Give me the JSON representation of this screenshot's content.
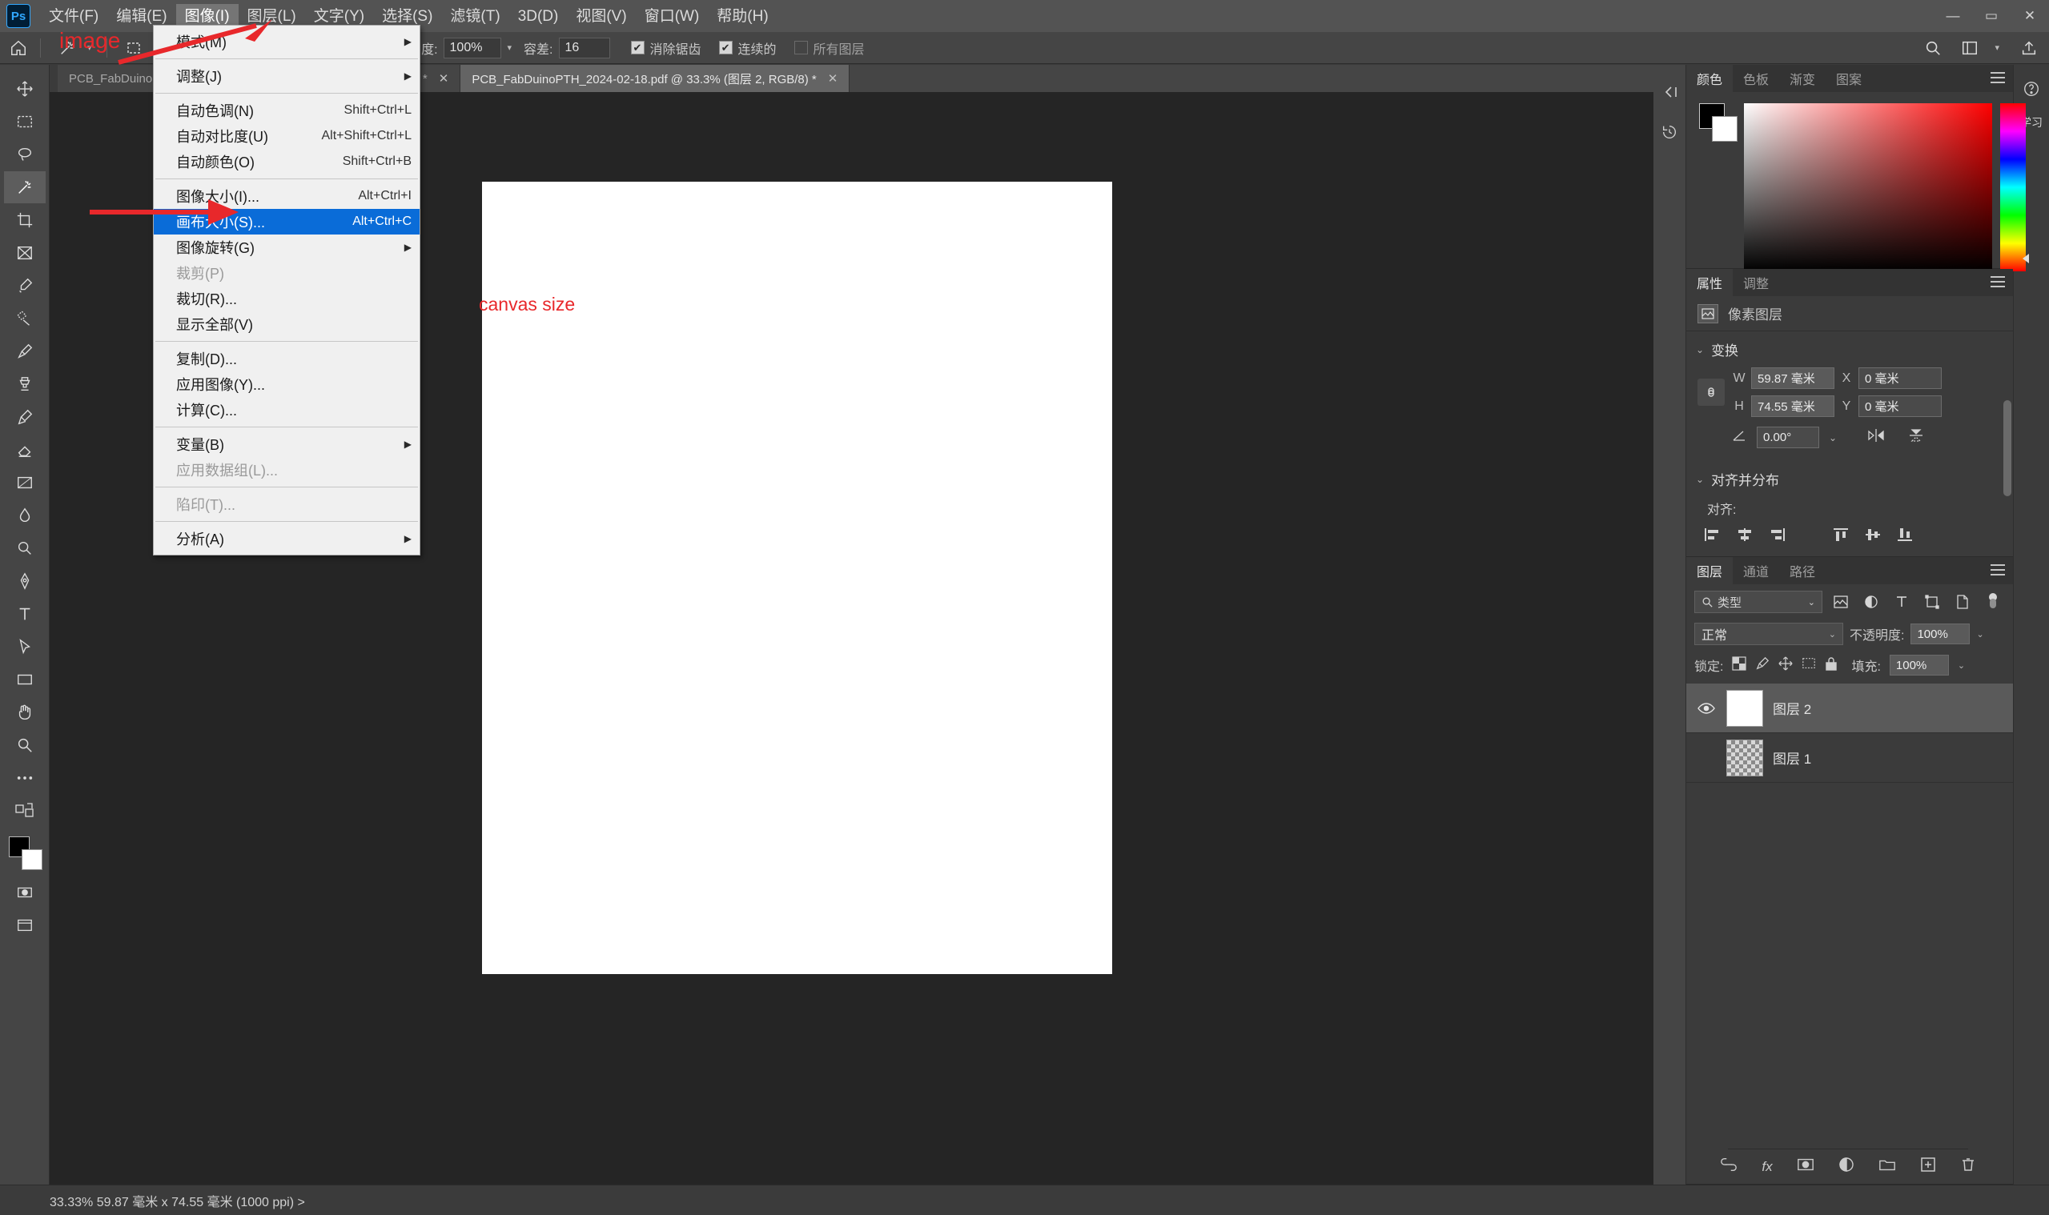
{
  "menubar": {
    "logo": "Ps",
    "items": [
      {
        "label": "文件(F)"
      },
      {
        "label": "编辑(E)"
      },
      {
        "label": "图像(I)"
      },
      {
        "label": "图层(L)"
      },
      {
        "label": "文字(Y)"
      },
      {
        "label": "选择(S)"
      },
      {
        "label": "滤镜(T)"
      },
      {
        "label": "3D(D)"
      },
      {
        "label": "视图(V)"
      },
      {
        "label": "窗口(W)"
      },
      {
        "label": "帮助(H)"
      }
    ],
    "active_index": 2,
    "window_buttons": [
      "—",
      "▭",
      "✕"
    ]
  },
  "optionsbar": {
    "opacity_label": "不透明度:",
    "opacity_value": "100%",
    "tolerance_label": "容差:",
    "tolerance_value": "16",
    "antialias_label": "消除锯齿",
    "antialias_checked": true,
    "contiguous_label": "连续的",
    "contiguous_checked": true,
    "all_layers_label": "所有图层",
    "all_layers_checked": false
  },
  "tabs": [
    {
      "label": "PCB_FabDuino",
      "suffix": "/8) *",
      "active": false
    },
    {
      "label": "PCB_FabDuinoPTH_2024-02-18.pdf @ 33.3% (图层 2, RGB/8) *",
      "active": true
    }
  ],
  "dropdown": {
    "items": [
      {
        "label": "模式(M)",
        "shortcut": "",
        "submenu": true,
        "disabled": false,
        "highlight": false
      },
      {
        "sep": true
      },
      {
        "label": "调整(J)",
        "shortcut": "",
        "submenu": true,
        "disabled": false,
        "highlight": false
      },
      {
        "sep": true
      },
      {
        "label": "自动色调(N)",
        "shortcut": "Shift+Ctrl+L",
        "submenu": false,
        "disabled": false,
        "highlight": false
      },
      {
        "label": "自动对比度(U)",
        "shortcut": "Alt+Shift+Ctrl+L",
        "submenu": false,
        "disabled": false,
        "highlight": false
      },
      {
        "label": "自动颜色(O)",
        "shortcut": "Shift+Ctrl+B",
        "submenu": false,
        "disabled": false,
        "highlight": false
      },
      {
        "sep": true
      },
      {
        "label": "图像大小(I)...",
        "shortcut": "Alt+Ctrl+I",
        "submenu": false,
        "disabled": false,
        "highlight": false
      },
      {
        "label": "画布大小(S)...",
        "shortcut": "Alt+Ctrl+C",
        "submenu": false,
        "disabled": false,
        "highlight": true
      },
      {
        "label": "图像旋转(G)",
        "shortcut": "",
        "submenu": true,
        "disabled": false,
        "highlight": false
      },
      {
        "label": "裁剪(P)",
        "shortcut": "",
        "submenu": false,
        "disabled": true,
        "highlight": false
      },
      {
        "label": "裁切(R)...",
        "shortcut": "",
        "submenu": false,
        "disabled": false,
        "highlight": false
      },
      {
        "label": "显示全部(V)",
        "shortcut": "",
        "submenu": false,
        "disabled": false,
        "highlight": false
      },
      {
        "sep": true
      },
      {
        "label": "复制(D)...",
        "shortcut": "",
        "submenu": false,
        "disabled": false,
        "highlight": false
      },
      {
        "label": "应用图像(Y)...",
        "shortcut": "",
        "submenu": false,
        "disabled": false,
        "highlight": false
      },
      {
        "label": "计算(C)...",
        "shortcut": "",
        "submenu": false,
        "disabled": false,
        "highlight": false
      },
      {
        "sep": true
      },
      {
        "label": "变量(B)",
        "shortcut": "",
        "submenu": true,
        "disabled": false,
        "highlight": false
      },
      {
        "label": "应用数据组(L)...",
        "shortcut": "",
        "submenu": false,
        "disabled": true,
        "highlight": false
      },
      {
        "sep": true
      },
      {
        "label": "陷印(T)...",
        "shortcut": "",
        "submenu": false,
        "disabled": true,
        "highlight": false
      },
      {
        "sep": true
      },
      {
        "label": "分析(A)",
        "shortcut": "",
        "submenu": true,
        "disabled": false,
        "highlight": false
      }
    ]
  },
  "annotations": {
    "image_text": "image",
    "canvas_size_text": "canvas size",
    "arrow_color": "#e8282b"
  },
  "panels": {
    "color": {
      "tabs": [
        "颜色",
        "色板",
        "渐变",
        "图案"
      ],
      "active": "颜色"
    },
    "properties": {
      "tabs": [
        "属性",
        "调整"
      ],
      "active": "属性",
      "kind_label": "像素图层",
      "transform_title": "变换",
      "w_label": "W",
      "w_value": "59.87 毫米",
      "x_label": "X",
      "x_value": "0 毫米",
      "h_label": "H",
      "h_value": "74.55 毫米",
      "y_label": "Y",
      "y_value": "0 毫米",
      "angle_value": "0.00°",
      "align_title": "对齐并分布",
      "align_label": "对齐:"
    },
    "layers": {
      "tabs": [
        "图层",
        "通道",
        "路径"
      ],
      "active": "图层",
      "filter_label": "类型",
      "blend_mode": "正常",
      "opacity_label": "不透明度:",
      "opacity_value": "100%",
      "lock_label": "锁定:",
      "fill_label": "填充:",
      "fill_value": "100%",
      "rows": [
        {
          "name": "图层 2",
          "visible": true,
          "selected": true,
          "thumb": "white"
        },
        {
          "name": "图层 1",
          "visible": false,
          "selected": false,
          "thumb": "checker"
        }
      ]
    },
    "learn_label": "学习"
  },
  "statusbar": {
    "text": "33.33%   59.87 毫米 x 74.55 毫米 (1000 ppi)  >"
  }
}
